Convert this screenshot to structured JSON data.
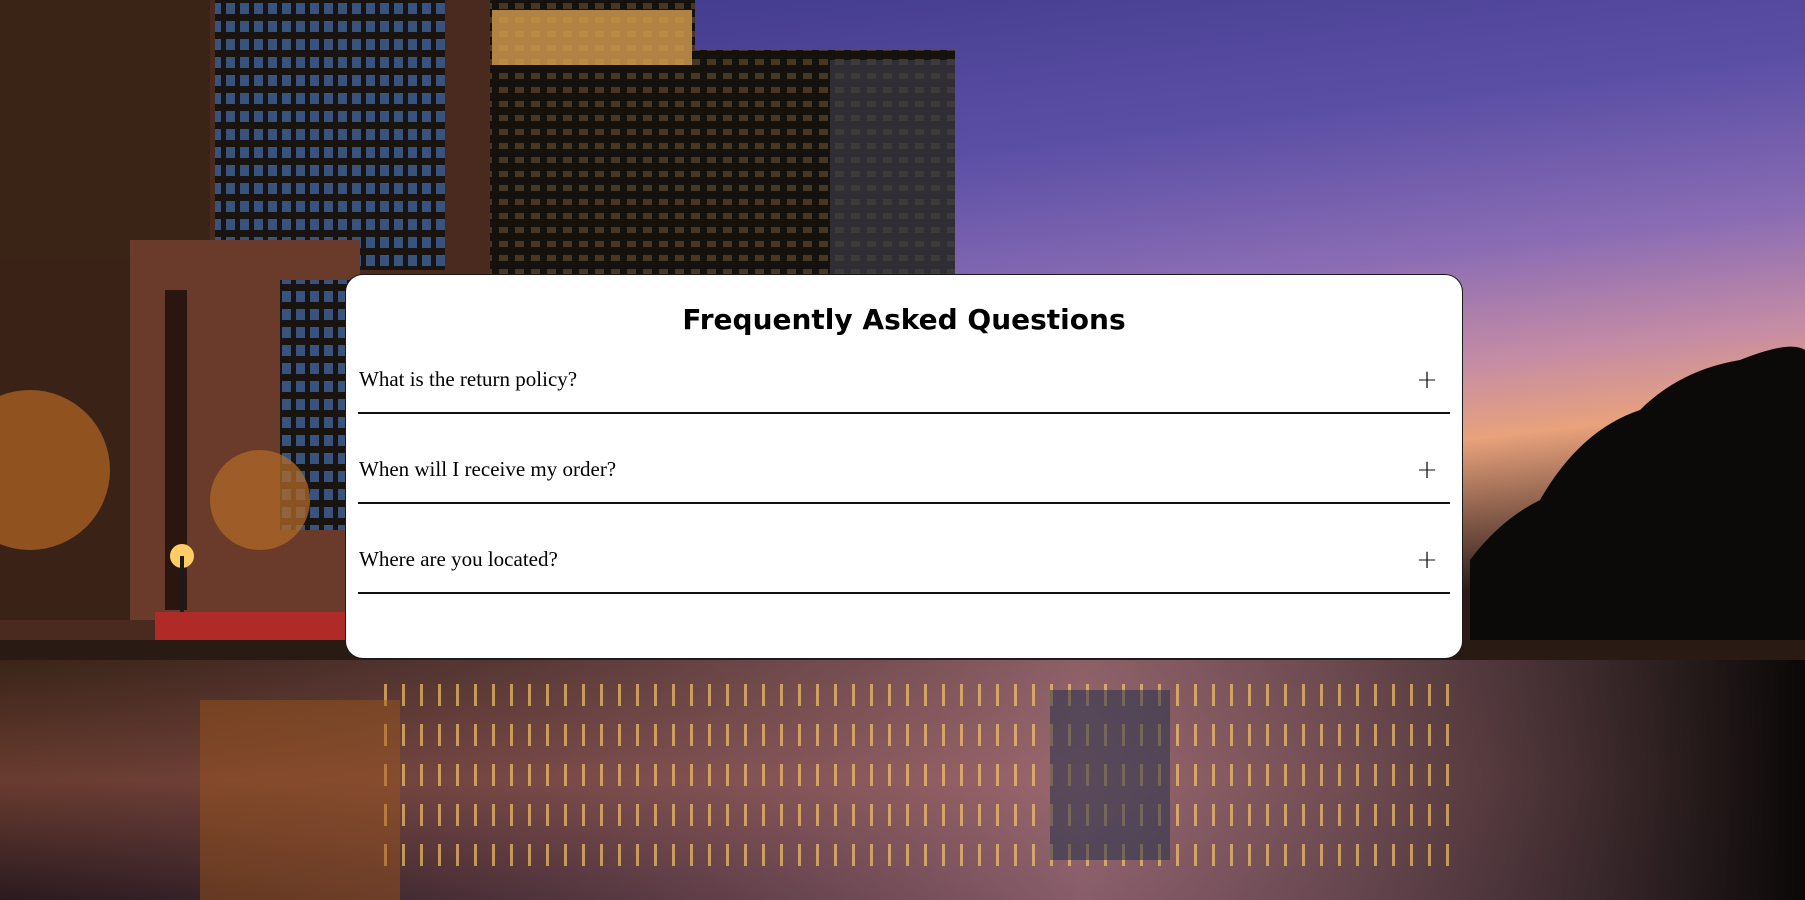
{
  "faq": {
    "title": "Frequently Asked Questions",
    "items": [
      {
        "question": "What is the return policy?",
        "toggle": "+"
      },
      {
        "question": "When will I receive my order?",
        "toggle": "+"
      },
      {
        "question": "Where are you located?",
        "toggle": "+"
      }
    ]
  },
  "colors": {
    "card_background": "#ffffff",
    "divider": "#111111",
    "sky_top": "#3d3a86",
    "sky_bottom": "#e0a090"
  },
  "icons": {
    "toggle": "plus-icon"
  }
}
